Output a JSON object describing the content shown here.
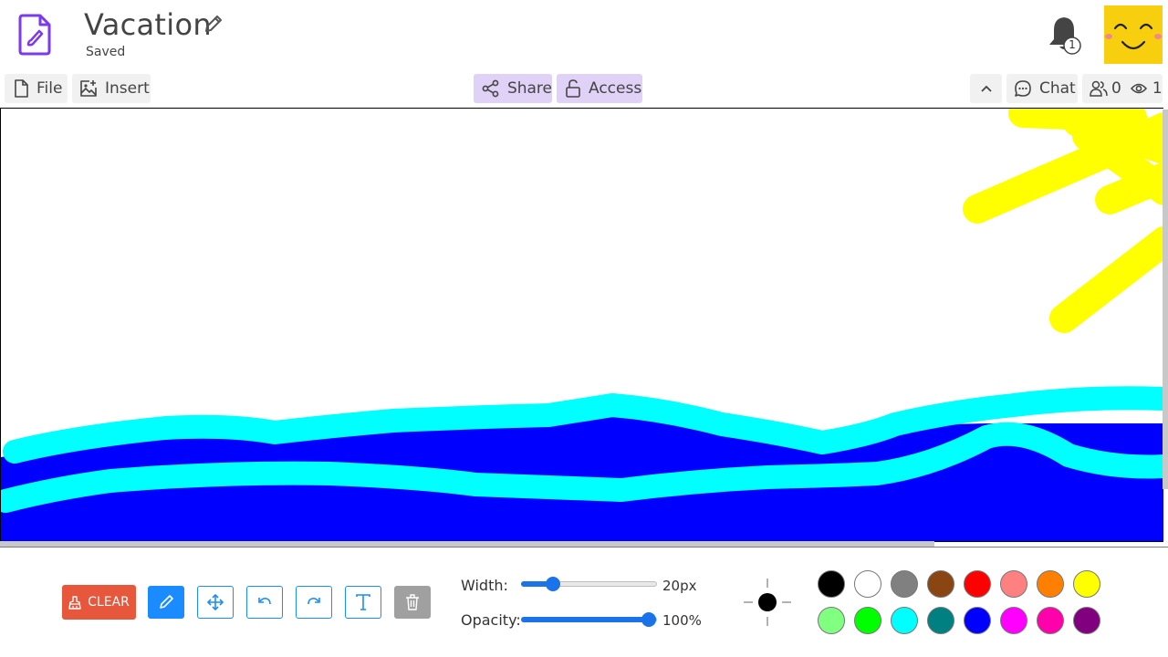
{
  "header": {
    "title": "Vacation",
    "status": "Saved",
    "notification_count": "1",
    "accent": "#7c3aed"
  },
  "toolbar": {
    "file_label": "File",
    "insert_label": "Insert",
    "share_label": "Share",
    "access_label": "Access",
    "chat_label": "Chat",
    "users_count": "0",
    "viewers_count": "1"
  },
  "canvas": {
    "drawing": {
      "colors": {
        "sky": "#ffffff",
        "sea": "#0000ff",
        "waves": "#00ffff",
        "sun": "#ffff00"
      }
    }
  },
  "tools": {
    "clear_label": "CLEAR",
    "items": [
      {
        "name": "pen-icon",
        "active": true
      },
      {
        "name": "move-icon",
        "active": false
      },
      {
        "name": "undo-icon",
        "active": false
      },
      {
        "name": "redo-icon",
        "active": false
      },
      {
        "name": "text-icon",
        "active": false
      },
      {
        "name": "trash-icon",
        "active": false,
        "disabled": true
      }
    ]
  },
  "width": {
    "label": "Width:",
    "value_text": "20px",
    "fraction": 0.23
  },
  "opacity": {
    "label": "Opacity:",
    "value_text": "100%",
    "fraction": 1.0
  },
  "current_color": "#000000",
  "palette": [
    [
      "#000000",
      "#ffffff",
      "#808080",
      "#8b4513",
      "#ff0000",
      "#ff8080",
      "#ff8000",
      "#ffff00"
    ],
    [
      "#80ff80",
      "#00ff00",
      "#00ffff",
      "#008080",
      "#0000ff",
      "#ff00ff",
      "#ff00aa",
      "#800080"
    ]
  ]
}
